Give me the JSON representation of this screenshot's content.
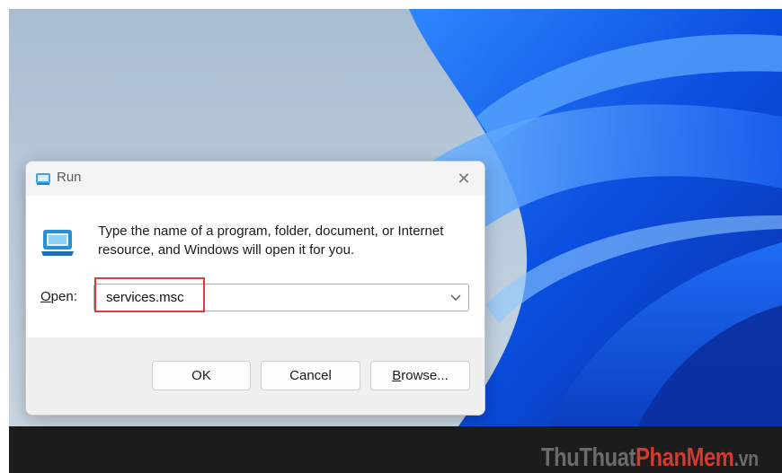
{
  "dialog": {
    "title": "Run",
    "close_glyph": "✕",
    "icon": "run-icon",
    "description": "Type the name of a program, folder, document, or Internet resource, and Windows will open it for you.",
    "open_label_mnemonic": "O",
    "open_label_rest": "pen:",
    "input_value": "services.msc",
    "buttons": {
      "ok": "OK",
      "cancel": "Cancel",
      "browse_mnemonic": "B",
      "browse_rest": "rowse..."
    }
  },
  "watermark": {
    "part1": "Thu",
    "part2": "Thuat",
    "part3": "Phan",
    "part4": "Mem",
    "part5": ".vn"
  },
  "colors": {
    "highlight": "#e0393e",
    "wallpaper_blue": "#1a5fe0"
  }
}
